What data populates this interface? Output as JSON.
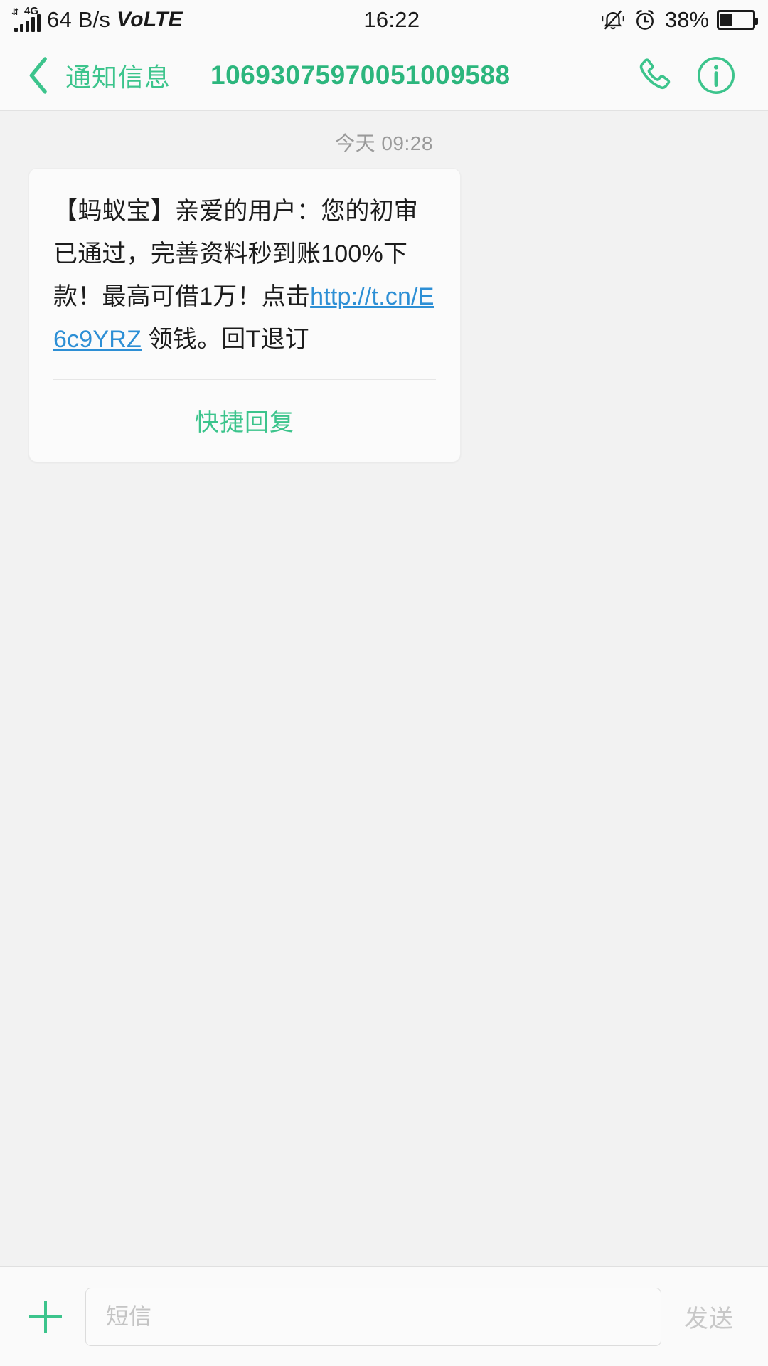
{
  "status_bar": {
    "network_type": "4G",
    "data_speed": "64 B/s",
    "volte_prefix": "Vo",
    "volte_suffix": "LTE",
    "clock": "16:22",
    "battery_percent": "38%",
    "battery_level": 38,
    "icons": [
      "signal-bars-icon",
      "silent-bell-icon",
      "alarm-clock-icon",
      "battery-icon"
    ]
  },
  "header": {
    "back_icon": "chevron-left-icon",
    "title": "通知信息",
    "sender_number": "10693075970051009588",
    "call_icon": "phone-call-icon",
    "info_icon": "info-circle-icon",
    "accent_color": "#3cc48c"
  },
  "conversation": {
    "date_separator": "今天 09:28",
    "message": {
      "segment_1": "【蚂蚁宝】亲爱的用户：您的初审已通过，完善资料秒到账100%下款！最高可借1万！点击",
      "link_text": "http://t.cn/E6c9YRZ",
      "link_color": "#2d8fd5",
      "segment_2": " 领钱。回T退订"
    },
    "quick_reply_label": "快捷回复"
  },
  "input_bar": {
    "add_icon": "plus-icon",
    "input_value": "",
    "input_placeholder": "短信",
    "send_label": "发送"
  }
}
